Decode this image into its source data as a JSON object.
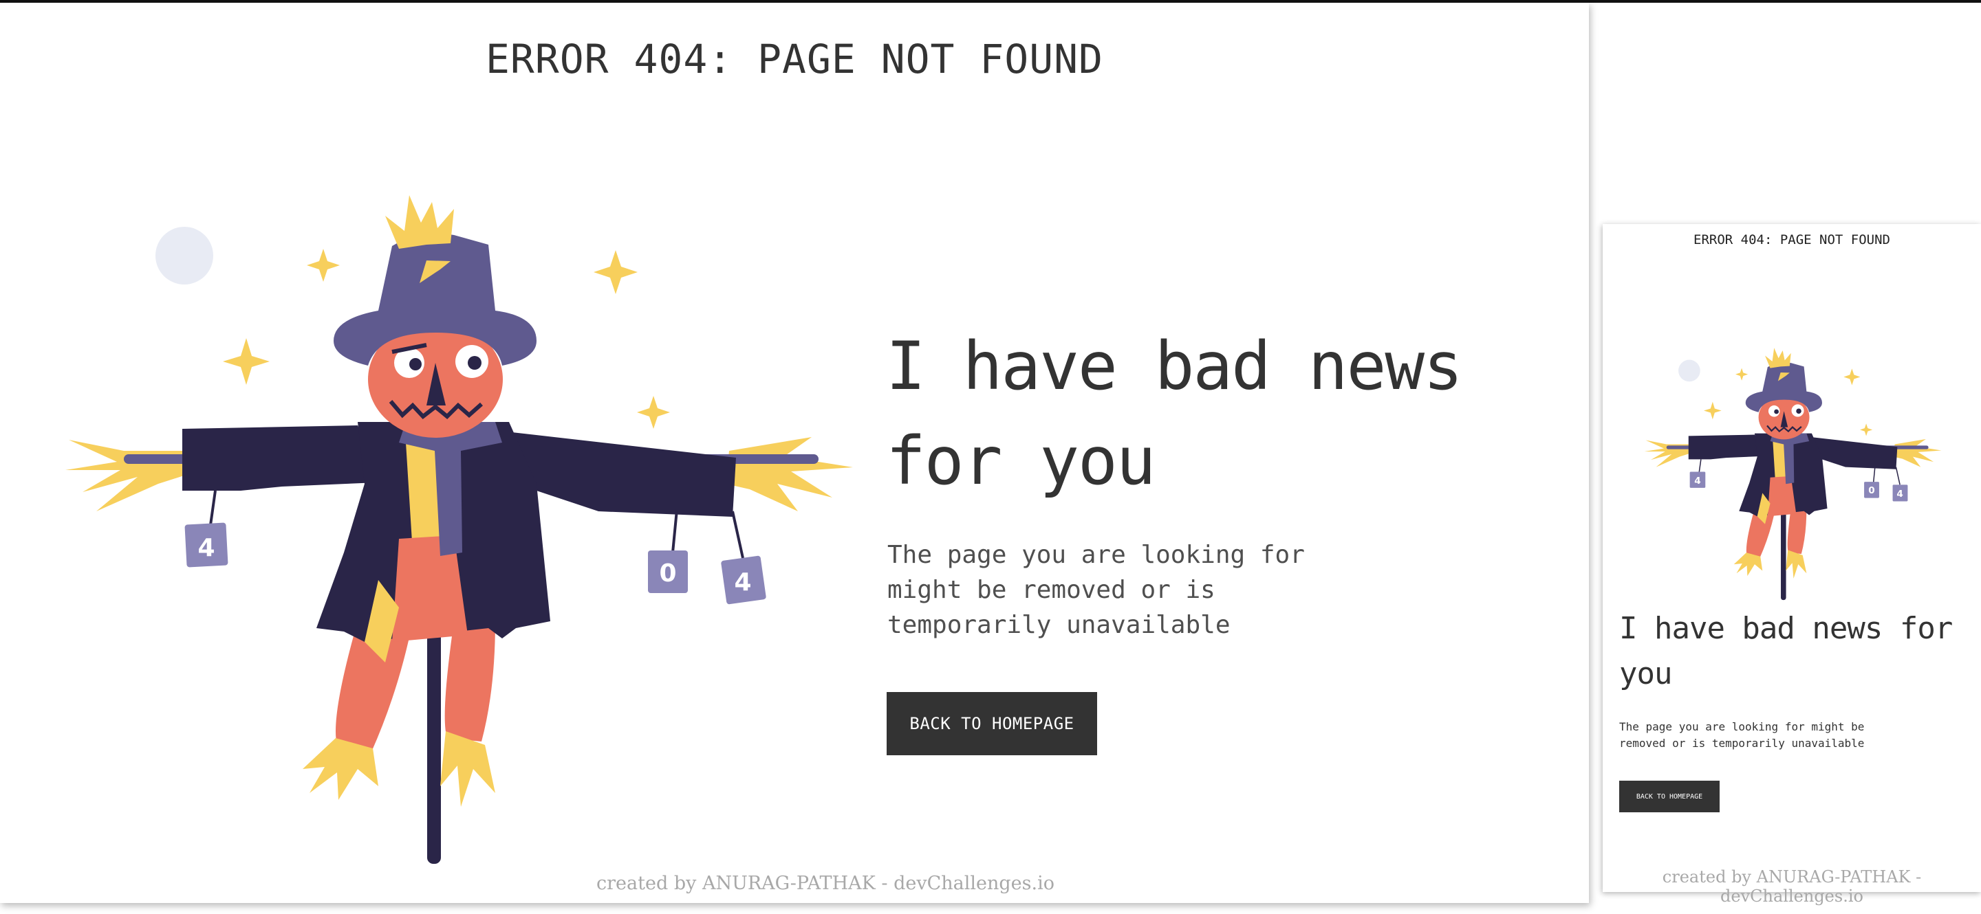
{
  "colors": {
    "dark_text": "#333333",
    "body_text": "#4f4f4f",
    "button_bg": "#333333",
    "button_text": "#ffffff",
    "footer_text": "#a8a8a8",
    "scarecrow_navy": "#2a2548",
    "scarecrow_purple": "#5f5a8f",
    "scarecrow_face": "#ec7560",
    "straw_yellow": "#f7cf5c",
    "moon": "#e8ebf4"
  },
  "desktop": {
    "header": "ERROR 404: PAGE NOT FOUND",
    "headline": "I have bad news for you",
    "body": "The page you are looking for might be removed or is temporarily unavailable",
    "button_label": "BACK TO HOMEPAGE",
    "footer": "created by ANURAG-PATHAK - devChallenges.io",
    "illustration": {
      "icon": "scarecrow-illustration",
      "can_labels": [
        "4",
        "0",
        "4"
      ]
    }
  },
  "mobile": {
    "header": "ERROR 404: PAGE NOT FOUND",
    "headline": "I have bad news for you",
    "body": "The page you are looking for might be removed or is temporarily unavailable",
    "button_label": "BACK TO HOMEPAGE",
    "footer": "created by ANURAG-PATHAK - devChallenges.io",
    "illustration": {
      "icon": "scarecrow-illustration",
      "can_labels": [
        "4",
        "0",
        "4"
      ]
    }
  }
}
